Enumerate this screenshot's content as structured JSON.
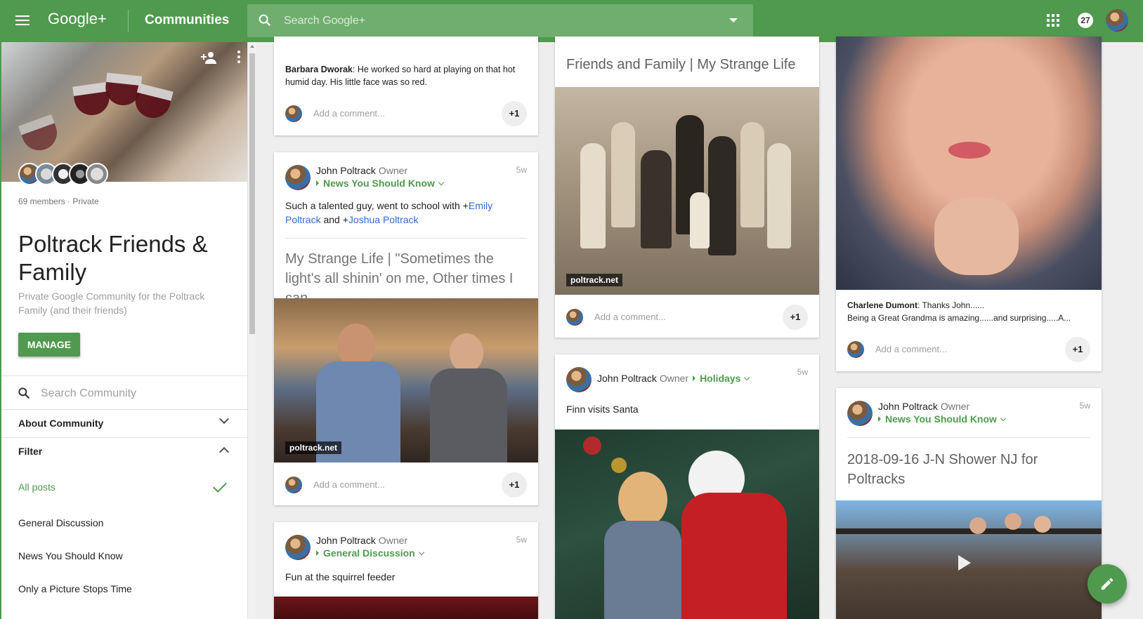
{
  "header": {
    "logo": "Google+",
    "title": "Communities",
    "search_placeholder": "Search Google+",
    "notification_count": "27"
  },
  "sidebar": {
    "meta": "69 members · Private",
    "name": "Poltrack Friends & Family",
    "description": "Private Google Community for the Poltrack Family (and their friends)",
    "manage_label": "MANAGE",
    "search_placeholder": "Search Community",
    "about_label": "About Community",
    "filter_label": "Filter",
    "filters": [
      "All posts",
      "General Discussion",
      "News You Should Know",
      "Only a Picture Stops Time"
    ]
  },
  "col1": {
    "card1": {
      "comment_author": "Barbara Dworak",
      "comment_text": ": He worked so hard at playing on that hot humid day. His little face was so red.",
      "add_comment": "Add a comment...",
      "plus_one": "+1"
    },
    "card2": {
      "author": "John Poltrack",
      "role": "Owner",
      "category": "News You Should Know",
      "time": "5w",
      "text_before": "Such a talented guy, went to school with +",
      "mention1": "Emily Poltrack",
      "text_mid": " and +",
      "mention2": "Joshua Poltrack",
      "link_title": "My Strange Life | \"Sometimes the light's all shinin' on me, Other times I can...",
      "photo_tag": "poltrack.net",
      "add_comment": "Add a comment...",
      "plus_one": "+1"
    },
    "card3": {
      "author": "John Poltrack",
      "role": "Owner",
      "category": "General Discussion",
      "time": "5w",
      "text": "Fun at the squirrel feeder"
    }
  },
  "col2": {
    "card1": {
      "link_title": "Friends and Family | My Strange Life",
      "photo_tag": "poltrack.net",
      "add_comment": "Add a comment...",
      "plus_one": "+1"
    },
    "card2": {
      "author": "John Poltrack",
      "role": "Owner",
      "category": "Holidays",
      "time": "5w",
      "text": "Finn visits Santa"
    }
  },
  "col3": {
    "card1": {
      "comment_author": "Charlene Dumont",
      "comment_text": ": Thanks John......",
      "comment_text2": "Being a Great Grandma is amazing......and surprising.....A...",
      "add_comment": "Add a comment...",
      "plus_one": "+1"
    },
    "card2": {
      "author": "John Poltrack",
      "role": "Owner",
      "category": "News You Should Know",
      "time": "5w",
      "link_title": "2018-09-16 J-N Shower NJ for Poltracks"
    }
  },
  "icons": [
    "menu-icon",
    "search-icon",
    "apps-icon",
    "add-member-icon",
    "more-vert-icon",
    "chevron-down-icon",
    "chevron-up-icon",
    "check-icon",
    "play-icon",
    "edit-icon"
  ],
  "colors": {
    "brand": "#4f9a4e",
    "mention": "#3367d6"
  }
}
